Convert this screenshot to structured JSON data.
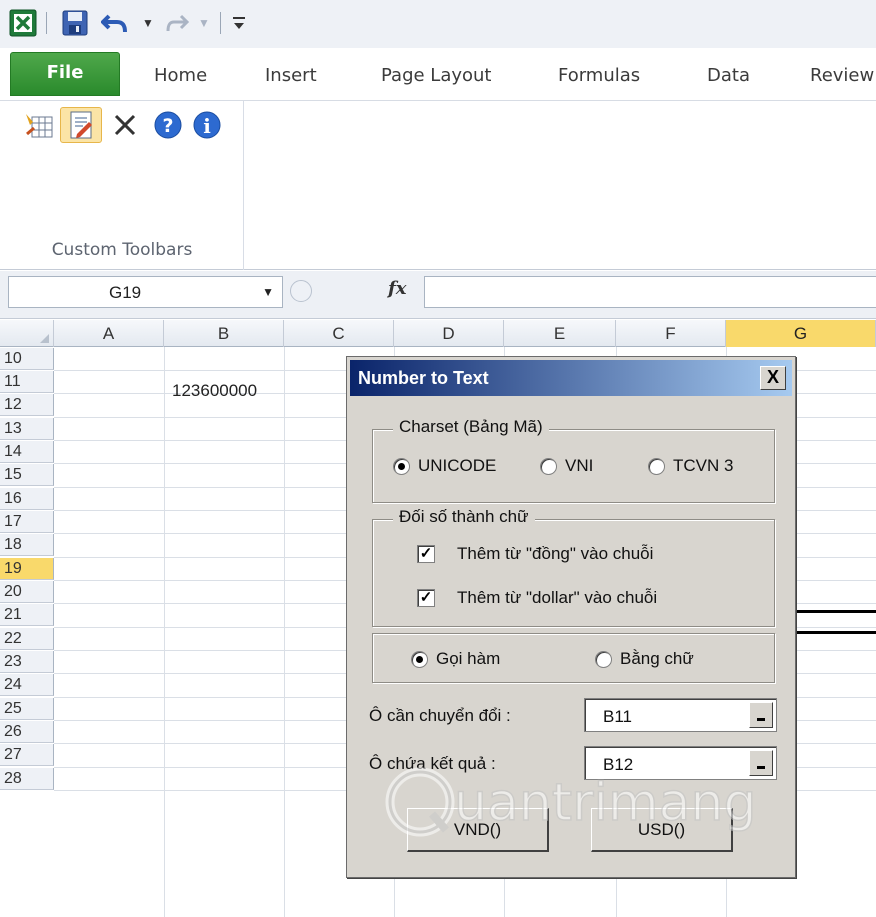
{
  "tabs": [
    "File",
    "Home",
    "Insert",
    "Page Layout",
    "Formulas",
    "Data",
    "Review"
  ],
  "ribbon": {
    "group_label": "Custom Toolbars",
    "icons": [
      "table-icon",
      "edit-form-icon",
      "close-icon",
      "help-icon",
      "info-icon"
    ]
  },
  "formula_bar": {
    "name_box": "G19",
    "fx_label": "fx",
    "formula": ""
  },
  "grid": {
    "columns": [
      "A",
      "B",
      "C",
      "D",
      "E",
      "F",
      "G"
    ],
    "selected_column": "G",
    "rows": [
      "10",
      "11",
      "12",
      "13",
      "14",
      "15",
      "16",
      "17",
      "18",
      "19",
      "20",
      "21",
      "22",
      "23",
      "24",
      "25",
      "26",
      "27",
      "28"
    ],
    "selected_row": "19",
    "cells": {
      "B11": "123600000"
    }
  },
  "dialog": {
    "title": "Number to Text",
    "close_label": "X",
    "charset": {
      "legend": "Charset (Bảng Mã)",
      "options": [
        "UNICODE",
        "VNI",
        "TCVN 3"
      ],
      "selected": "UNICODE"
    },
    "convert": {
      "legend": "Đối số thành chữ",
      "options": [
        {
          "label": "Thêm từ \"đồng\" vào chuỗi",
          "checked": true
        },
        {
          "label": "Thêm từ \"dollar\" vào chuỗi",
          "checked": true
        }
      ]
    },
    "mode": {
      "options": [
        "Gọi hàm",
        "Bằng chữ"
      ],
      "selected": "Gọi hàm"
    },
    "source_cell": {
      "label": "Ô cần chuyển đổi :",
      "value": "B11"
    },
    "result_cell": {
      "label": "Ô chứa kết quả :",
      "value": "B12"
    },
    "buttons": {
      "vnd": "VND()",
      "usd": "USD()"
    }
  },
  "watermark": "Quantrimang",
  "colors": {
    "file_tab": "#2a8a2c",
    "selection": "#f9d96b",
    "dialog_bg": "#d8d5cf",
    "title_start": "#0a246a",
    "title_end": "#a6caf0"
  }
}
